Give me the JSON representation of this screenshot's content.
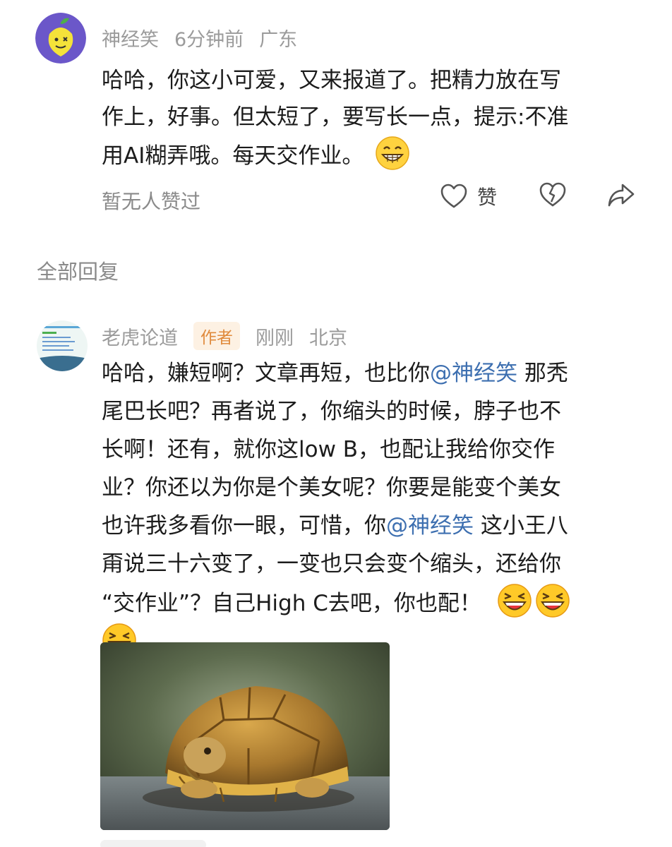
{
  "comment1": {
    "username": "神经笑",
    "time": "6分钟前",
    "location": "广东",
    "text_lines": [
      "哈哈，你这小可爱，又来报道了。把精力放在写",
      "作上，好事。但太短了，要写长一点，提示:不准",
      "用AI糊弄哦。每天交作业。"
    ],
    "no_likes_text": "暂无人赞过",
    "like_label": "赞"
  },
  "section_title": "全部回复",
  "reply1": {
    "username": "老虎论道",
    "author_badge": "作者",
    "time": "刚刚",
    "location": "北京",
    "l1_a": "哈哈，嫌短啊？文章再短，也比你",
    "l1_mention": "@神经笑",
    "l1_b": " 那秃",
    "l2": "尾巴长吧？再者说了，你缩头的时候，脖子也不",
    "l3": "长啊！还有，就你这low B，也配让我给你交作",
    "l4": "业？你还以为你是个美女呢？你要是能变个美女",
    "l5_a": "也许我多看你一眼，可惜，你",
    "l5_mention": "@神经笑",
    "l5_b": " 这小王八",
    "l6": "甭说三十六变了，一变也只会变个缩头，还给你",
    "l7": "“交作业”？自己High C去吧，你也配！"
  },
  "icons": {
    "like": "heart-outline-icon",
    "dislike": "broken-heart-icon",
    "share": "share-arrow-icon",
    "emoji_grin": "grinning-emoji",
    "emoji_laugh": "laughing-emoji"
  },
  "colors": {
    "mention": "#3d6fb0",
    "badge_bg": "#fdf1e3",
    "badge_text": "#e08a3c",
    "meta_gray": "#9b9b9b"
  }
}
